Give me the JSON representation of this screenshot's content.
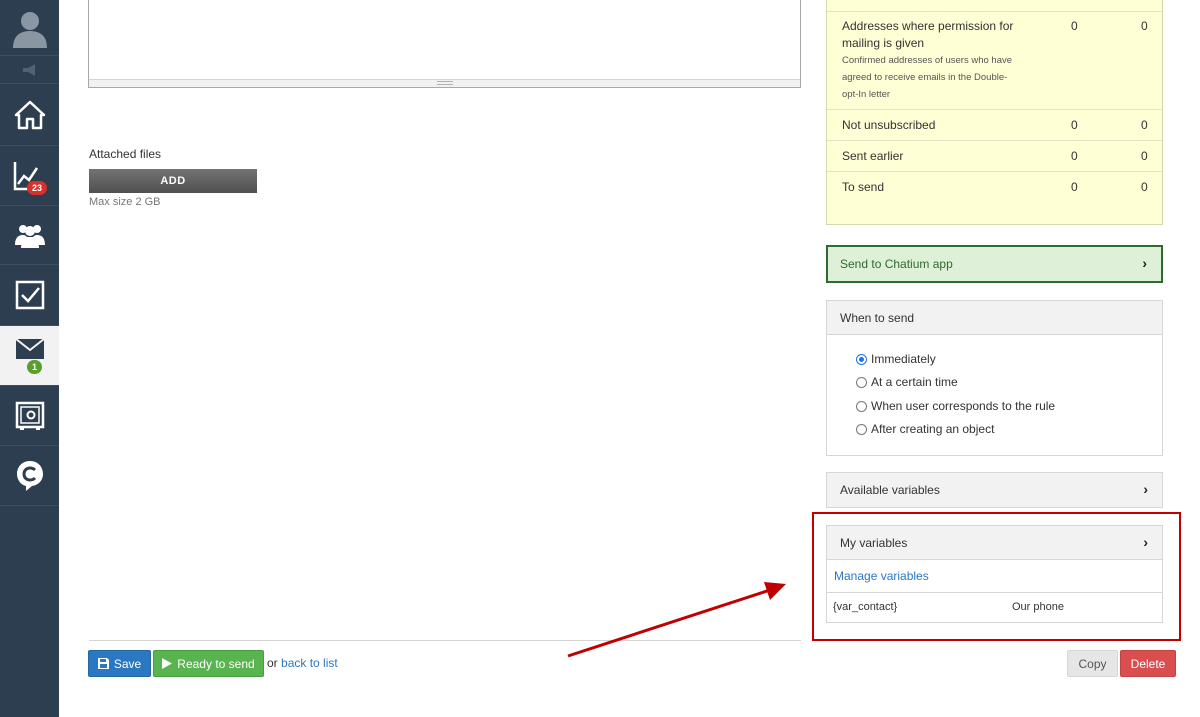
{
  "sidebar": {
    "items": [
      {
        "name": "avatar"
      },
      {
        "name": "collapse"
      },
      {
        "name": "home"
      },
      {
        "name": "stats",
        "badge": "23"
      },
      {
        "name": "users"
      },
      {
        "name": "tasks"
      },
      {
        "name": "mail",
        "badge": "1",
        "active": true
      },
      {
        "name": "safe"
      },
      {
        "name": "chatium"
      }
    ]
  },
  "attached": {
    "label": "Attached files",
    "add_label": "ADD",
    "max_size": "Max size 2 GB"
  },
  "stats": {
    "rows": [
      {
        "label": "Addresses where permission for mailing is given",
        "sub": "Confirmed addresses of users who have agreed to receive emails in the Double-opt-In letter",
        "v1": "0",
        "v2": "0"
      },
      {
        "label": "Not unsubscribed",
        "v1": "0",
        "v2": "0"
      },
      {
        "label": "Sent earlier",
        "v1": "0",
        "v2": "0"
      },
      {
        "label": "To send",
        "v1": "0",
        "v2": "0"
      }
    ]
  },
  "chatium": {
    "label": "Send to Chatium app"
  },
  "when_to_send": {
    "title": "When to send",
    "options": [
      "Immediately",
      "At a certain time",
      "When user corresponds to the rule",
      "After creating an object"
    ],
    "selected": "Immediately"
  },
  "available_variables": {
    "title": "Available variables"
  },
  "my_variables": {
    "title": "My variables",
    "manage_label": "Manage variables",
    "rows": [
      {
        "key": "{var_contact}",
        "desc": "Our phone"
      }
    ]
  },
  "actions": {
    "save_label": "Save",
    "ready_label": "Ready to send",
    "or_text": "or",
    "back_label": "back to list",
    "copy_label": "Copy",
    "delete_label": "Delete"
  },
  "colors": {
    "accent": "#2b78c2",
    "success": "#58b44e",
    "danger": "#d94f4f",
    "sidebar": "#2d3e50",
    "annotation": "#c00000"
  }
}
